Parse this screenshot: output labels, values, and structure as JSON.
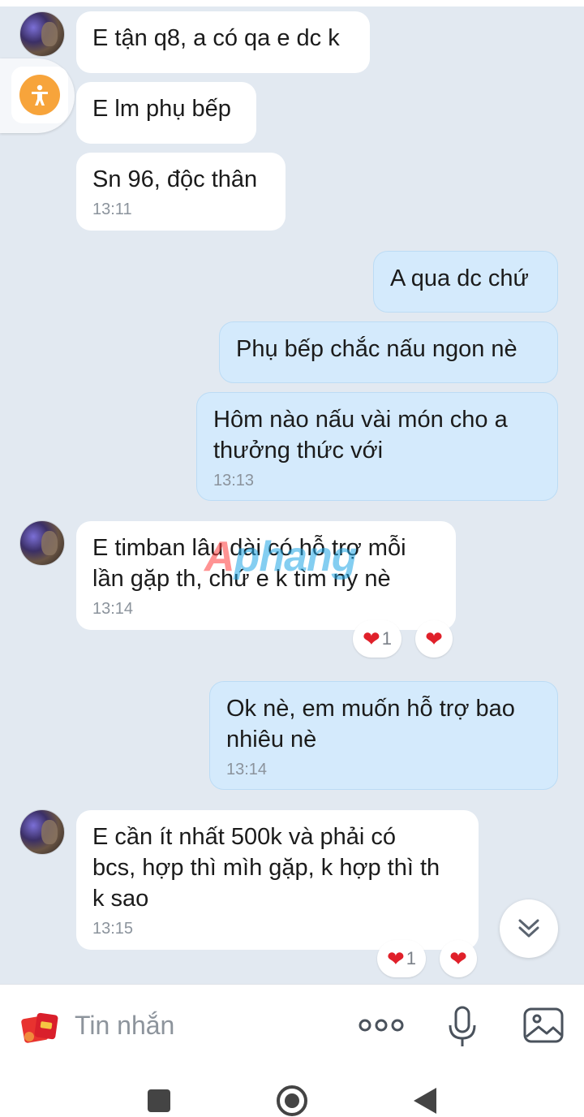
{
  "messages": [
    {
      "text": "E tận q8, a có qa e dc k",
      "time": null,
      "dir": "in"
    },
    {
      "text": "E lm phụ bếp",
      "time": null,
      "dir": "in"
    },
    {
      "text": "Sn 96, độc thân",
      "time": "13:11",
      "dir": "in"
    },
    {
      "text": "A qua dc chứ",
      "time": null,
      "dir": "out"
    },
    {
      "text": "Phụ bếp chắc nấu ngon nè",
      "time": null,
      "dir": "out"
    },
    {
      "line1": "Hôm nào nấu vài món cho a",
      "line2": "thưởng thức với",
      "time": "13:13",
      "dir": "out"
    },
    {
      "line1": "E timban lâu dài có hỗ trợ mỗi",
      "line2": "lần gặp th, chứ e k tìm ny nè",
      "time": "13:14",
      "dir": "in"
    },
    {
      "line1": "Ok nè, em muốn hỗ trợ bao",
      "line2": "nhiêu nè",
      "time": "13:14",
      "dir": "out"
    },
    {
      "line1": "E cần ít nhất 500k và phải có",
      "line2": "bcs, hợp thì mìh gặp, k hợp thì th",
      "line3": "k sao",
      "time": "13:15",
      "dir": "in"
    }
  ],
  "reactions": {
    "heart_glyph": "❤",
    "count": "1"
  },
  "watermark": {
    "first": "A",
    "rest": "phang"
  },
  "composer": {
    "placeholder": "Tin nhắn"
  },
  "icons": [
    "accessibility-icon",
    "scroll-down-icon",
    "sticker-icon",
    "more-options-icon",
    "microphone-icon",
    "image-icon"
  ],
  "colors": {
    "background": "#e2e9f1",
    "incoming_bubble": "#ffffff",
    "outgoing_bubble": "#d4eafc",
    "heart": "#e0202a",
    "accessibility": "#f7a43b"
  }
}
